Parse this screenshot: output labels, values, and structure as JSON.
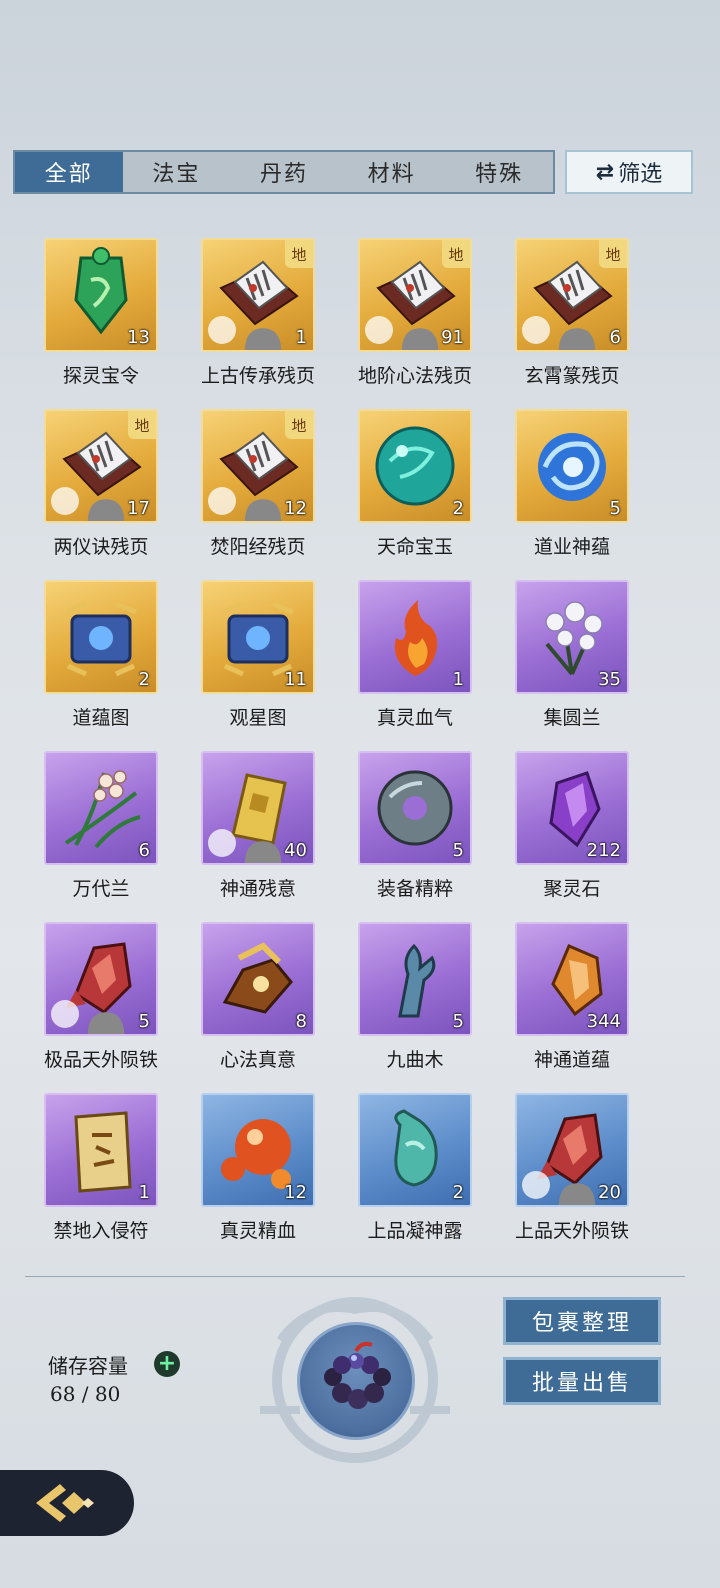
{
  "tabs": [
    {
      "label": "全部",
      "active": true
    },
    {
      "label": "法宝",
      "active": false
    },
    {
      "label": "丹药",
      "active": false
    },
    {
      "label": "材料",
      "active": false
    },
    {
      "label": "特殊",
      "active": false
    }
  ],
  "filter": {
    "icon": "swap-arrows-icon",
    "label": "筛选"
  },
  "items": [
    {
      "name": "探灵宝令",
      "count": "13",
      "rarity": "gold",
      "icon": "jade-token-icon",
      "badge": "",
      "puzzle": false
    },
    {
      "name": "上古传承残页",
      "count": "1",
      "rarity": "gold",
      "icon": "scroll-book-icon",
      "badge": "地",
      "puzzle": true
    },
    {
      "name": "地阶心法残页",
      "count": "91",
      "rarity": "gold",
      "icon": "scroll-book-icon",
      "badge": "地",
      "puzzle": true
    },
    {
      "name": "玄霄篆残页",
      "count": "6",
      "rarity": "gold",
      "icon": "scroll-book-icon",
      "badge": "地",
      "puzzle": true
    },
    {
      "name": "两仪诀残页",
      "count": "17",
      "rarity": "gold",
      "icon": "scroll-book-icon",
      "badge": "地",
      "puzzle": true
    },
    {
      "name": "焚阳经残页",
      "count": "12",
      "rarity": "gold",
      "icon": "scroll-book-icon",
      "badge": "地",
      "puzzle": true
    },
    {
      "name": "天命宝玉",
      "count": "2",
      "rarity": "gold",
      "icon": "teal-orb-icon",
      "badge": "",
      "puzzle": false
    },
    {
      "name": "道业神蕴",
      "count": "5",
      "rarity": "gold",
      "icon": "blue-swirl-icon",
      "badge": "",
      "puzzle": false
    },
    {
      "name": "道蕴图",
      "count": "2",
      "rarity": "gold",
      "icon": "map-scroll-icon",
      "badge": "",
      "puzzle": false
    },
    {
      "name": "观星图",
      "count": "11",
      "rarity": "gold",
      "icon": "map-scroll-icon",
      "badge": "",
      "puzzle": false
    },
    {
      "name": "真灵血气",
      "count": "1",
      "rarity": "purple",
      "icon": "flame-icon",
      "badge": "",
      "puzzle": false
    },
    {
      "name": "集圆兰",
      "count": "35",
      "rarity": "purple",
      "icon": "white-flower-icon",
      "badge": "",
      "puzzle": false
    },
    {
      "name": "万代兰",
      "count": "6",
      "rarity": "purple",
      "icon": "orchid-icon",
      "badge": "",
      "puzzle": false
    },
    {
      "name": "神通残意",
      "count": "40",
      "rarity": "purple",
      "icon": "golden-shard-icon",
      "badge": "",
      "puzzle": true
    },
    {
      "name": "装备精粹",
      "count": "5",
      "rarity": "purple",
      "icon": "stone-ring-icon",
      "badge": "",
      "puzzle": false
    },
    {
      "name": "聚灵石",
      "count": "212",
      "rarity": "purple",
      "icon": "purple-crystal-icon",
      "badge": "",
      "puzzle": false
    },
    {
      "name": "极品天外陨铁",
      "count": "5",
      "rarity": "purple",
      "icon": "red-crystal-icon",
      "badge": "",
      "puzzle": true
    },
    {
      "name": "心法真意",
      "count": "8",
      "rarity": "purple",
      "icon": "broken-relic-icon",
      "badge": "",
      "puzzle": false
    },
    {
      "name": "九曲木",
      "count": "5",
      "rarity": "purple",
      "icon": "driftwood-icon",
      "badge": "",
      "puzzle": false
    },
    {
      "name": "神通道蕴",
      "count": "344",
      "rarity": "purple",
      "icon": "amber-crystal-icon",
      "badge": "",
      "puzzle": false
    },
    {
      "name": "禁地入侵符",
      "count": "1",
      "rarity": "purple",
      "icon": "talisman-icon",
      "badge": "",
      "puzzle": false
    },
    {
      "name": "真灵精血",
      "count": "12",
      "rarity": "blue",
      "icon": "red-orbs-icon",
      "badge": "",
      "puzzle": false
    },
    {
      "name": "上品凝神露",
      "count": "2",
      "rarity": "blue",
      "icon": "teal-vase-icon",
      "badge": "",
      "puzzle": false
    },
    {
      "name": "上品天外陨铁",
      "count": "20",
      "rarity": "blue",
      "icon": "red-crystal-icon",
      "badge": "",
      "puzzle": true
    }
  ],
  "storage": {
    "label": "储存容量",
    "value": "68 / 80"
  },
  "actions": {
    "organize": "包裹整理",
    "bulk_sell": "批量出售"
  },
  "colors": {
    "gold": "#e4ab3c",
    "purple": "#9a6ed4",
    "blue": "#5d8dca",
    "accent": "#3e6c96"
  }
}
